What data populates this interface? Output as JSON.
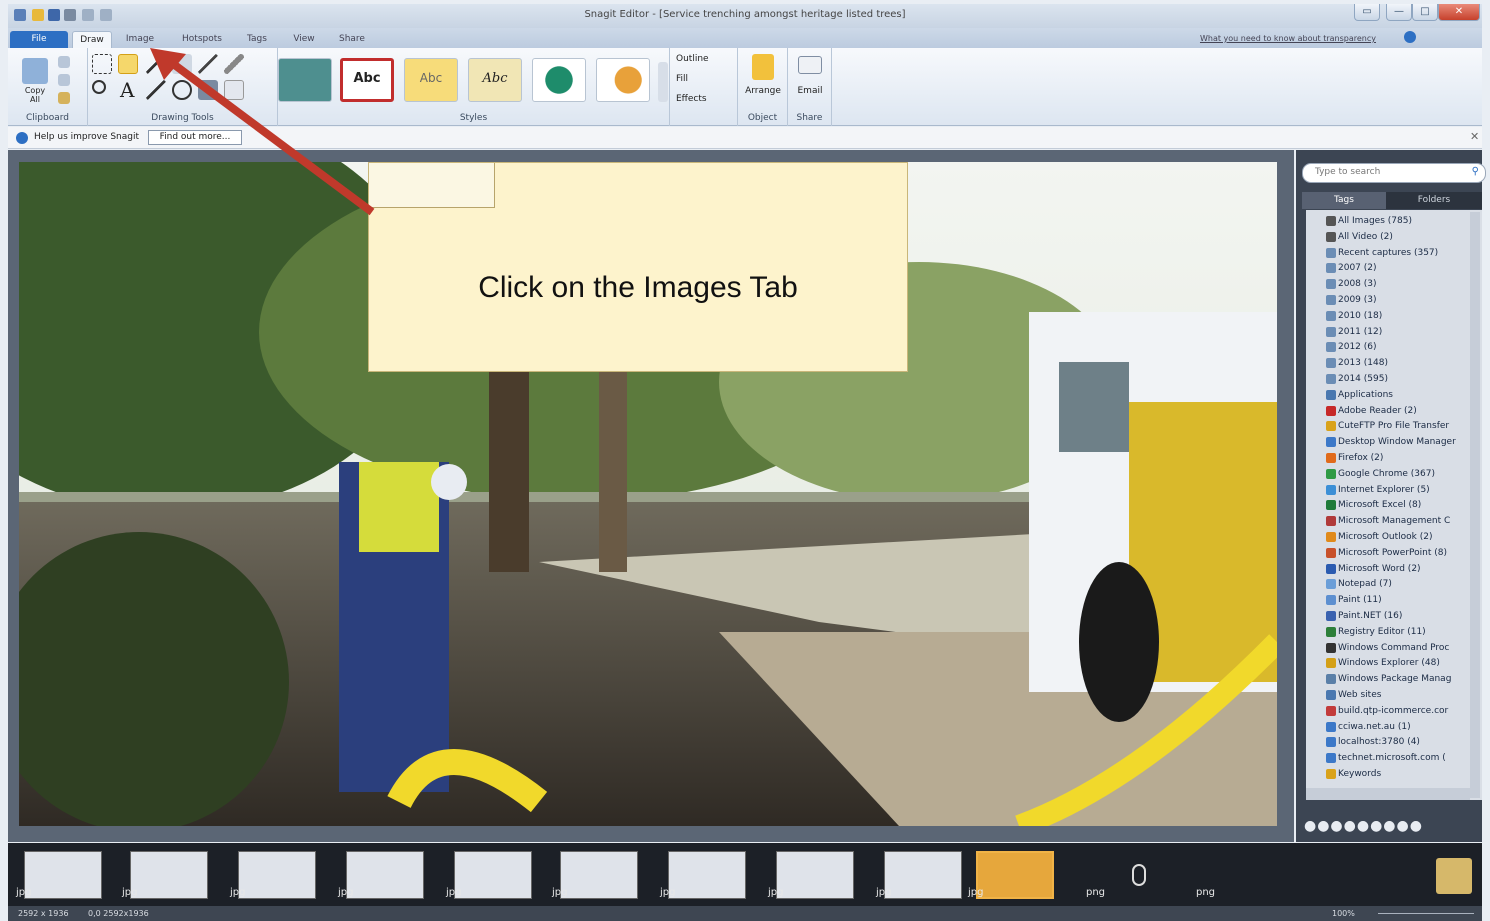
{
  "window": {
    "title": "Snagit Editor - [Service trenching amongst heritage listed trees]"
  },
  "tabs": [
    {
      "label": "File"
    },
    {
      "label": "Draw"
    },
    {
      "label": "Image"
    },
    {
      "label": "Hotspots"
    },
    {
      "label": "Tags"
    },
    {
      "label": "View"
    },
    {
      "label": "Share"
    }
  ],
  "help_link": "What you need to know about transparency",
  "ribbon": {
    "clipboard": {
      "copy_all": "Copy All",
      "label": "Clipboard"
    },
    "drawing_tools": {
      "label": "Drawing Tools"
    },
    "styles": {
      "label": "Styles",
      "abc": "Abc",
      "abc_light": "Abc",
      "abc_script": "Abc"
    },
    "format": {
      "outline": "Outline",
      "fill": "Fill",
      "effects": "Effects"
    },
    "object": {
      "arrange": "Arrange",
      "label": "Object"
    },
    "share": {
      "email": "Email",
      "label": "Share"
    }
  },
  "helpbar": {
    "text": "Help us improve Snagit",
    "button": "Find out more..."
  },
  "callout": {
    "text": "Click on the Images Tab"
  },
  "panel": {
    "search_placeholder": "Type to search",
    "tabs": [
      "Tags",
      "Folders"
    ],
    "items": [
      "All Images (785)",
      "All Video (2)",
      "Recent captures (357)",
      "2007 (2)",
      "2008 (3)",
      "2009 (3)",
      "2010 (18)",
      "2011 (12)",
      "2012 (6)",
      "2013 (148)",
      "2014 (595)",
      "Applications",
      "Adobe Reader (2)",
      "CuteFTP Pro File Transfer",
      "Desktop Window Manager",
      "Firefox (2)",
      "Google Chrome (367)",
      "Internet Explorer (5)",
      "Microsoft Excel (8)",
      "Microsoft Management C",
      "Microsoft Outlook (2)",
      "Microsoft PowerPoint (8)",
      "Microsoft Word (2)",
      "Notepad (7)",
      "Paint (11)",
      "Paint.NET (16)",
      "Registry Editor (11)",
      "Windows Command Proc",
      "Windows Explorer (48)",
      "Windows Package Manag",
      "Web sites",
      "build.qtp-icommerce.cor",
      "cciwa.net.au (1)",
      "localhost:3780 (4)",
      "technet.microsoft.com (",
      "Keywords"
    ],
    "item_colors": [
      "#555",
      "#555",
      "#6b8db5",
      "#6b8db5",
      "#6b8db5",
      "#6b8db5",
      "#6b8db5",
      "#6b8db5",
      "#6b8db5",
      "#6b8db5",
      "#6b8db5",
      "#4a78b0",
      "#c62828",
      "#d9a21b",
      "#3c78c8",
      "#e06a1b",
      "#2f9a45",
      "#3c8fd6",
      "#1f7b3a",
      "#b03a3a",
      "#e08a1b",
      "#c8512b",
      "#2b5bb0",
      "#6b9ed8",
      "#5d8fd0",
      "#3a62b0",
      "#2d7f3a",
      "#333",
      "#d4a017",
      "#5a7fa8",
      "#4a78b0",
      "#c23b3b",
      "#3c78c8",
      "#3c78c8",
      "#3c78c8",
      "#d9a21b"
    ]
  },
  "tray": {
    "labels": [
      "jpg",
      "jpg",
      "jpg",
      "jpg",
      "jpg",
      "jpg",
      "jpg",
      "jpg",
      "jpg",
      "jpg",
      "png",
      "png"
    ]
  },
  "status": {
    "size": "2592 x 1936",
    "pos": "0,0  2592x1936",
    "zoom": "100%"
  }
}
